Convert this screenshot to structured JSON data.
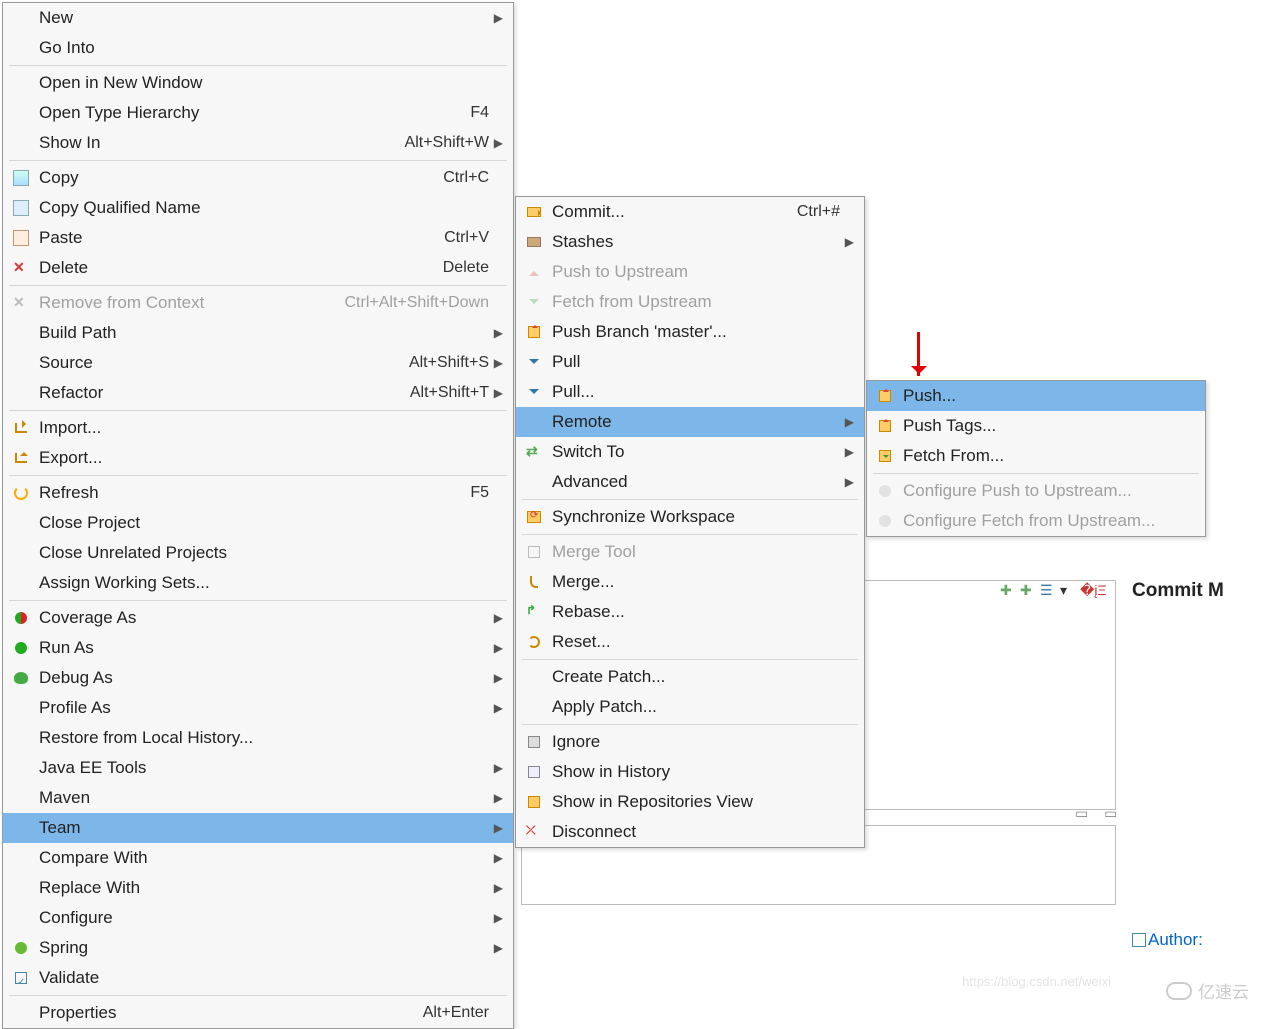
{
  "menu1": {
    "groups": [
      [
        {
          "label": "New",
          "shortcut": "",
          "sub": true,
          "icon": ""
        },
        {
          "label": "Go Into",
          "shortcut": "",
          "icon": ""
        }
      ],
      [
        {
          "label": "Open in New Window",
          "icon": ""
        },
        {
          "label": "Open Type Hierarchy",
          "shortcut": "F4",
          "icon": ""
        },
        {
          "label": "Show In",
          "shortcut": "Alt+Shift+W",
          "sub": true,
          "icon": ""
        }
      ],
      [
        {
          "label": "Copy",
          "shortcut": "Ctrl+C",
          "icon": "ic-copy",
          "iconName": "copy-icon"
        },
        {
          "label": "Copy Qualified Name",
          "icon": "ic-copyq",
          "iconName": "copy-qualified-icon"
        },
        {
          "label": "Paste",
          "shortcut": "Ctrl+V",
          "icon": "ic-paste",
          "iconName": "paste-icon"
        },
        {
          "label": "Delete",
          "shortcut": "Delete",
          "icon": "ic-delete",
          "iconText": "✕",
          "iconName": "delete-icon"
        }
      ],
      [
        {
          "label": "Remove from Context",
          "shortcut": "Ctrl+Alt+Shift+Down",
          "disabled": true,
          "icon": "ic-remove",
          "iconText": "✕",
          "iconName": "remove-icon"
        },
        {
          "label": "Build Path",
          "sub": true,
          "icon": ""
        },
        {
          "label": "Source",
          "shortcut": "Alt+Shift+S",
          "sub": true,
          "icon": ""
        },
        {
          "label": "Refactor",
          "shortcut": "Alt+Shift+T",
          "sub": true,
          "icon": ""
        }
      ],
      [
        {
          "label": "Import...",
          "icon": "ic-import",
          "iconName": "import-icon"
        },
        {
          "label": "Export...",
          "icon": "ic-export",
          "iconName": "export-icon"
        }
      ],
      [
        {
          "label": "Refresh",
          "shortcut": "F5",
          "icon": "ic-refresh",
          "iconName": "refresh-icon"
        },
        {
          "label": "Close Project",
          "icon": ""
        },
        {
          "label": "Close Unrelated Projects",
          "icon": ""
        },
        {
          "label": "Assign Working Sets...",
          "icon": ""
        }
      ],
      [
        {
          "label": "Coverage As",
          "sub": true,
          "icon": "ic-coverage",
          "iconName": "coverage-icon"
        },
        {
          "label": "Run As",
          "sub": true,
          "icon": "ic-run",
          "iconName": "run-icon"
        },
        {
          "label": "Debug As",
          "sub": true,
          "icon": "ic-debug",
          "iconName": "debug-icon"
        },
        {
          "label": "Profile As",
          "sub": true,
          "icon": ""
        },
        {
          "label": "Restore from Local History...",
          "icon": ""
        },
        {
          "label": "Java EE Tools",
          "sub": true,
          "icon": ""
        },
        {
          "label": "Maven",
          "sub": true,
          "icon": ""
        },
        {
          "label": "Team",
          "sub": true,
          "selected": true,
          "icon": ""
        },
        {
          "label": "Compare With",
          "sub": true,
          "icon": ""
        },
        {
          "label": "Replace With",
          "sub": true,
          "icon": ""
        },
        {
          "label": "Configure",
          "sub": true,
          "icon": ""
        },
        {
          "label": "Spring",
          "sub": true,
          "icon": "ic-spring",
          "iconName": "spring-icon"
        },
        {
          "label": "Validate",
          "icon": "ic-validate",
          "iconName": "validate-icon"
        }
      ],
      [
        {
          "label": "Properties",
          "shortcut": "Alt+Enter",
          "icon": ""
        }
      ]
    ]
  },
  "menu2": {
    "groups": [
      [
        {
          "label": "Commit...",
          "shortcut": "Ctrl+#",
          "icon": "ic-commit",
          "iconName": "commit-icon"
        },
        {
          "label": "Stashes",
          "sub": true,
          "icon": "ic-stash",
          "iconName": "stash-icon"
        },
        {
          "label": "Push to Upstream",
          "disabled": true,
          "icon": "ic-push ic-pushd",
          "iconName": "push-upstream-icon"
        },
        {
          "label": "Fetch from Upstream",
          "disabled": true,
          "icon": "ic-fetch ic-fetchd",
          "iconName": "fetch-upstream-icon"
        },
        {
          "label": "Push Branch 'master'...",
          "icon": "ic-push-box",
          "iconName": "push-branch-icon"
        },
        {
          "label": "Pull",
          "icon": "ic-pull",
          "iconName": "pull-icon"
        },
        {
          "label": "Pull...",
          "icon": "ic-pull",
          "iconName": "pull-dialog-icon"
        },
        {
          "label": "Remote",
          "sub": true,
          "selected": true,
          "icon": ""
        },
        {
          "label": "Switch To",
          "sub": true,
          "icon": "ic-switch",
          "iconText": "⇄",
          "iconName": "switch-icon"
        },
        {
          "label": "Advanced",
          "sub": true,
          "icon": ""
        }
      ],
      [
        {
          "label": "Synchronize Workspace",
          "icon": "ic-sync",
          "iconName": "sync-icon"
        }
      ],
      [
        {
          "label": "Merge Tool",
          "disabled": true,
          "icon": "ic-mergetool",
          "iconName": "merge-tool-icon"
        },
        {
          "label": "Merge...",
          "icon": "ic-merge",
          "iconName": "merge-icon"
        },
        {
          "label": "Rebase...",
          "icon": "ic-rebase",
          "iconText": "↱",
          "iconName": "rebase-icon"
        },
        {
          "label": "Reset...",
          "icon": "ic-reset",
          "iconName": "reset-icon"
        }
      ],
      [
        {
          "label": "Create Patch...",
          "icon": ""
        },
        {
          "label": "Apply Patch...",
          "icon": ""
        }
      ],
      [
        {
          "label": "Ignore",
          "icon": "ic-ignore",
          "iconName": "ignore-icon"
        },
        {
          "label": "Show in History",
          "icon": "ic-history",
          "iconName": "history-icon"
        },
        {
          "label": "Show in Repositories View",
          "icon": "ic-repoview",
          "iconName": "repo-view-icon"
        },
        {
          "label": "Disconnect",
          "icon": "ic-disconnect",
          "iconText": "⤫",
          "iconName": "disconnect-icon"
        }
      ]
    ]
  },
  "menu3": {
    "groups": [
      [
        {
          "label": "Push...",
          "selected": true,
          "icon": "ic-push-box",
          "iconName": "push-icon"
        },
        {
          "label": "Push Tags...",
          "icon": "ic-push-box",
          "iconName": "push-tags-icon"
        },
        {
          "label": "Fetch From...",
          "icon": "ic-fetch-box",
          "iconName": "fetch-from-icon"
        }
      ],
      [
        {
          "label": "Configure Push to Upstream...",
          "disabled": true,
          "icon": "ic-gear ic-pushd",
          "iconName": "config-push-icon"
        },
        {
          "label": "Configure Fetch from Upstream...",
          "disabled": true,
          "icon": "ic-gear ic-fetchd",
          "iconName": "config-fetch-icon"
        }
      ]
    ]
  },
  "panel": {
    "commit_header": "Commit M",
    "author_label": "Author:",
    "watermark": "亿速云",
    "csdn": "https://blog.csdn.net/weixi"
  }
}
